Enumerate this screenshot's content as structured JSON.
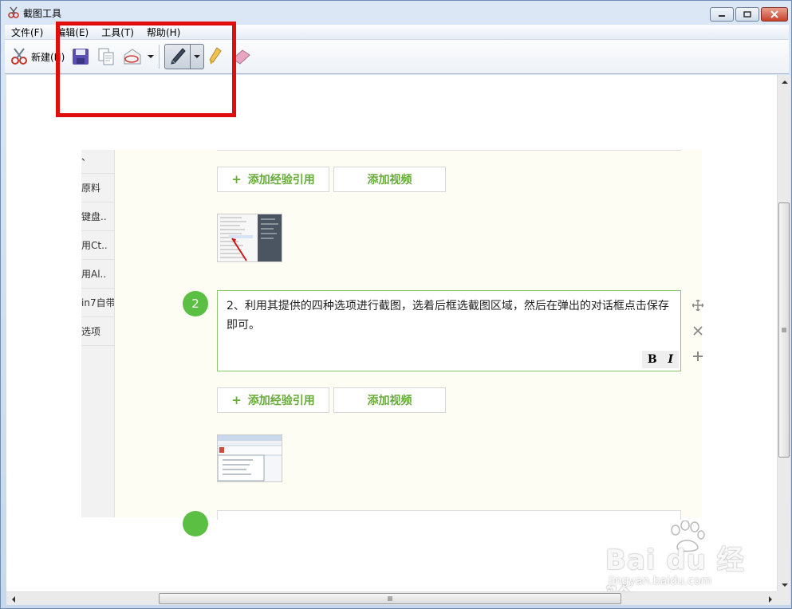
{
  "window": {
    "title": "截图工具"
  },
  "menu": [
    {
      "label": "文件(F)"
    },
    {
      "label": "编辑(E)"
    },
    {
      "label": "工具(T)"
    },
    {
      "label": "帮助(H)"
    }
  ],
  "toolbar": {
    "new_label": "新建(N)",
    "icons": [
      "scissors-icon",
      "save-icon",
      "copy-icon",
      "send-icon",
      "pen-icon",
      "highlighter-icon",
      "eraser-icon"
    ]
  },
  "capture": {
    "sidebar": [
      "、",
      "原料",
      "键盘..",
      "用Ct..",
      "用Al..",
      "in7自带",
      "选项"
    ],
    "buttons": {
      "add_reference": "添加经验引用",
      "add_video": "添加视频",
      "plus": "+"
    },
    "step2": {
      "number": "2",
      "text": "2、利用其提供的四种选项进行截图，选着后框选截图区域，然后在弹出的对话框点击保存即可。",
      "bold": "B",
      "italic": "I"
    }
  },
  "watermark": {
    "main": "Bai du 经验",
    "sub": "jingyan.baidu.com"
  },
  "colors": {
    "highlight_box": "#e00d0d",
    "accent_green": "#67ab3a",
    "step_circle": "#5bbf43"
  }
}
